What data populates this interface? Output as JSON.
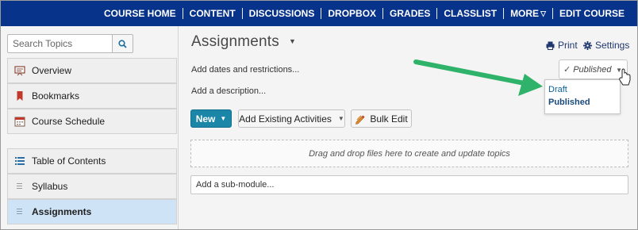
{
  "nav": {
    "items": [
      "COURSE HOME",
      "CONTENT",
      "DISCUSSIONS",
      "DROPBOX",
      "GRADES",
      "CLASSLIST",
      "MORE",
      "EDIT COURSE"
    ],
    "more_caret": "▽"
  },
  "sidebar": {
    "search_placeholder": "Search Topics",
    "items": [
      {
        "label": "Overview",
        "icon": "overview-icon"
      },
      {
        "label": "Bookmarks",
        "icon": "bookmark-icon"
      },
      {
        "label": "Course Schedule",
        "icon": "calendar-icon"
      }
    ],
    "toc": [
      {
        "label": "Table of Contents",
        "icon": "list-icon"
      },
      {
        "label": "Syllabus",
        "icon": "drag-handle-icon"
      },
      {
        "label": "Assignments",
        "icon": "drag-handle-icon",
        "active": true
      }
    ]
  },
  "main": {
    "title": "Assignments",
    "print_label": "Print",
    "settings_label": "Settings",
    "add_dates": "Add dates and restrictions...",
    "add_description": "Add a description...",
    "status": {
      "selected": "Published",
      "options": [
        "Draft",
        "Published"
      ]
    },
    "buttons": {
      "new": "New",
      "add_existing": "Add Existing Activities",
      "bulk_edit": "Bulk Edit"
    },
    "dropzone": "Drag and drop files here to create and update topics",
    "submodule_placeholder": "Add a sub-module..."
  },
  "colors": {
    "nav_bg": "#07338a",
    "primary_button": "#1b86a8",
    "active_item": "#cfe3f6",
    "annotation_arrow": "#2fb36a"
  }
}
